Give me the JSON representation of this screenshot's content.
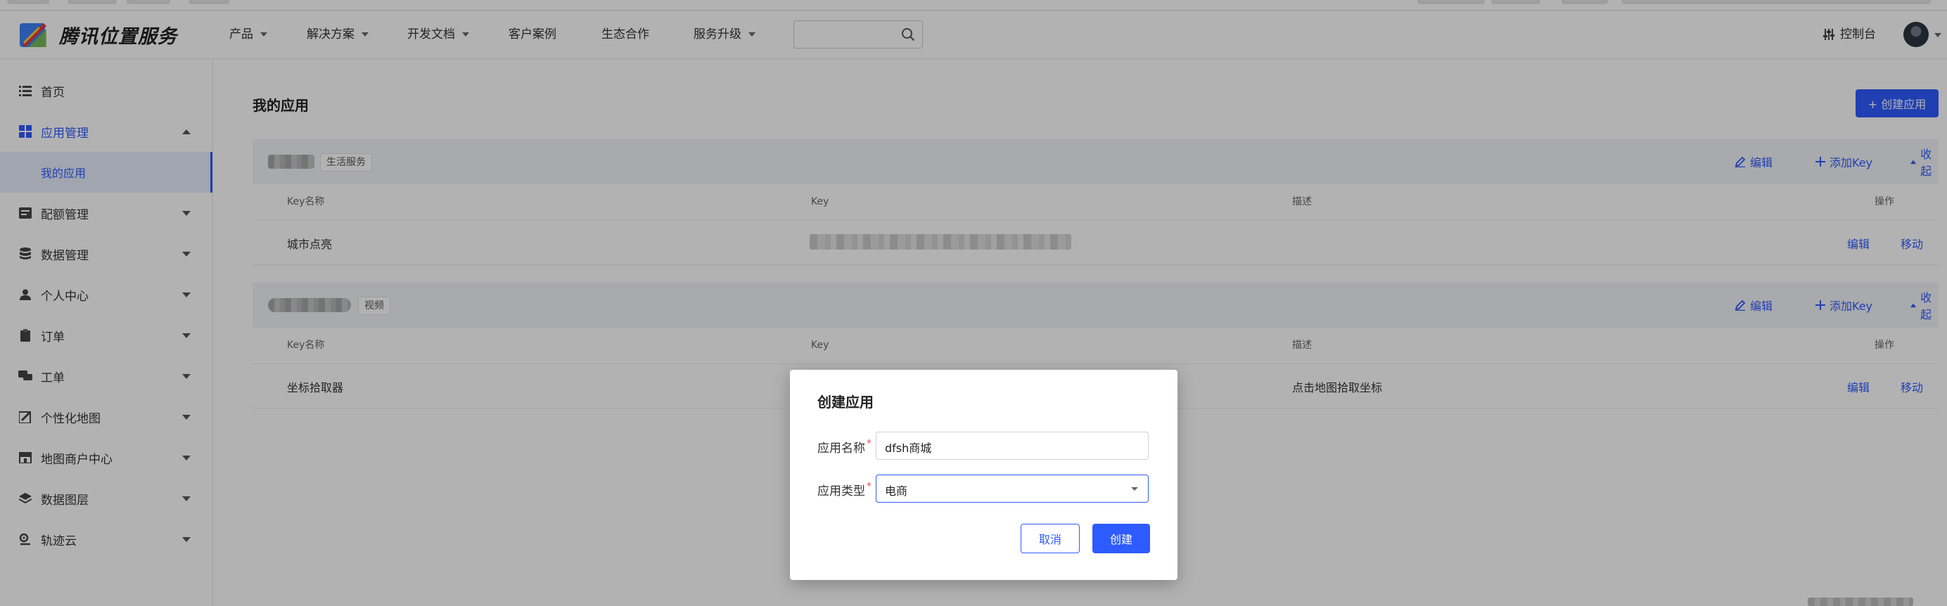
{
  "brand": {
    "name": "腾讯位置服务"
  },
  "nav": {
    "items": [
      {
        "label": "产品",
        "has_caret": true
      },
      {
        "label": "解决方案",
        "has_caret": true
      },
      {
        "label": "开发文档",
        "has_caret": true
      },
      {
        "label": "客户案例",
        "has_caret": false
      },
      {
        "label": "生态合作",
        "has_caret": false
      },
      {
        "label": "服务升级",
        "has_caret": true
      }
    ],
    "search_value": "",
    "console_label": "控制台"
  },
  "sidebar": {
    "items": [
      {
        "label": "首页",
        "icon": "list-icon"
      },
      {
        "label": "应用管理",
        "icon": "grid-icon",
        "expanded": true
      },
      {
        "label": "配额管理",
        "icon": "quota-icon"
      },
      {
        "label": "数据管理",
        "icon": "database-icon"
      },
      {
        "label": "个人中心",
        "icon": "user-icon"
      },
      {
        "label": "订单",
        "icon": "clipboard-icon"
      },
      {
        "label": "工单",
        "icon": "chat-icon"
      },
      {
        "label": "个性化地图",
        "icon": "map-style-icon"
      },
      {
        "label": "地图商户中心",
        "icon": "store-icon"
      },
      {
        "label": "数据图层",
        "icon": "layers-icon"
      },
      {
        "label": "轨迹云",
        "icon": "track-icon"
      }
    ],
    "subitem": {
      "label": "我的应用"
    }
  },
  "main": {
    "title": "我的应用",
    "create_button": "+ 创建应用",
    "cards": [
      {
        "tag": "生活服务",
        "actions": {
          "edit": "编辑",
          "add_key": "添加Key",
          "collapse": "收起"
        },
        "columns": {
          "key_name": "Key名称",
          "key": "Key",
          "desc": "描述",
          "ops": "操作"
        },
        "rows": [
          {
            "key_name": "城市点亮",
            "desc": "",
            "edit": "编辑",
            "move": "移动"
          }
        ]
      },
      {
        "tag": "视频",
        "actions": {
          "edit": "编辑",
          "add_key": "添加Key",
          "collapse": "收起"
        },
        "columns": {
          "key_name": "Key名称",
          "key": "Key",
          "desc": "描述",
          "ops": "操作"
        },
        "rows": [
          {
            "key_name": "坐标拾取器",
            "desc": "点击地图拾取坐标",
            "edit": "编辑",
            "move": "移动"
          }
        ]
      }
    ]
  },
  "modal": {
    "title": "创建应用",
    "name_label": "应用名称",
    "name_value": "dfsh商城",
    "type_label": "应用类型",
    "type_value": "电商",
    "required_mark": "*",
    "cancel": "取消",
    "confirm": "创建"
  },
  "colors": {
    "accent": "#2e5bff",
    "overlay": "rgba(0,0,0,0.30)"
  }
}
